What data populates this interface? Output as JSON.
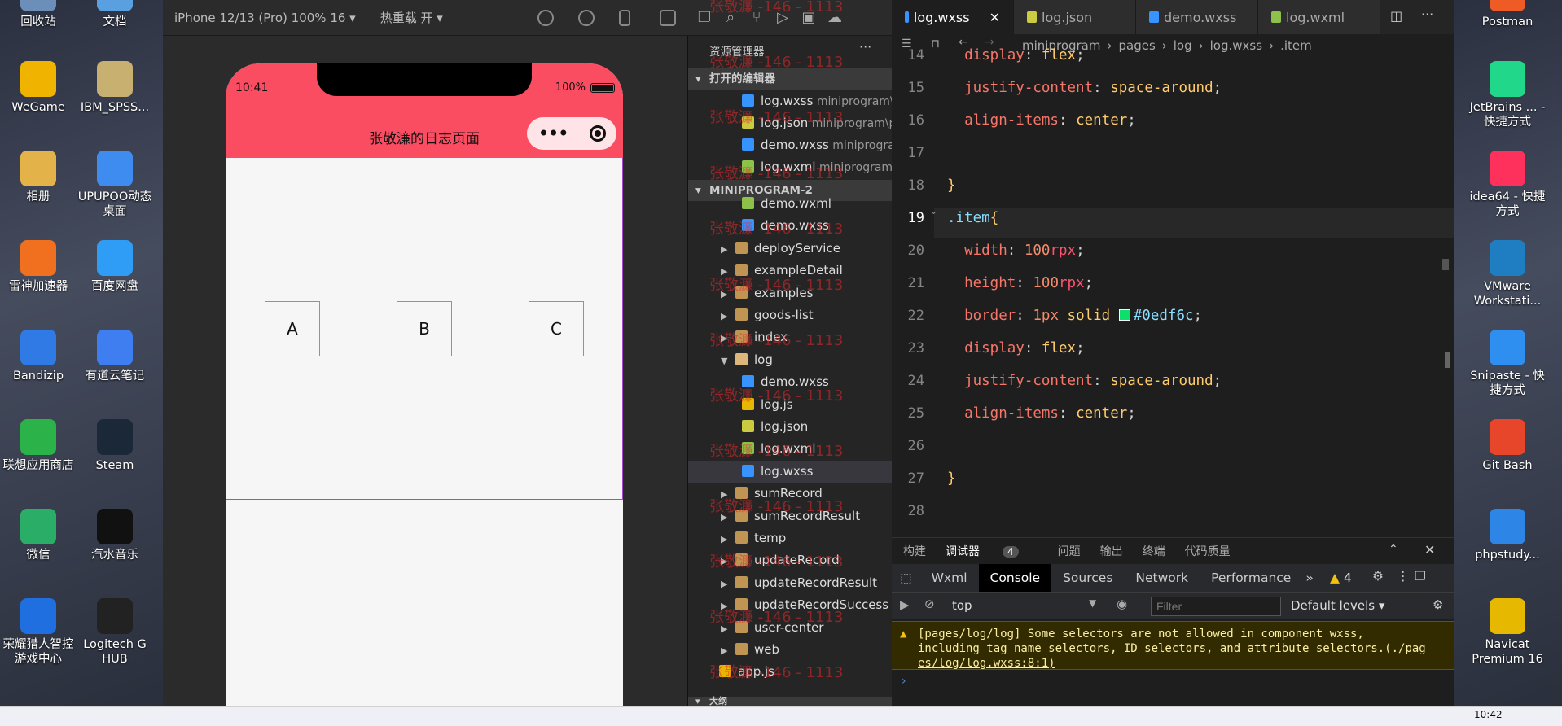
{
  "desktop_left": [
    {
      "label": "回收站",
      "icon": "recycle-bin-icon",
      "color": "#6b8fb8"
    },
    {
      "label": "文档",
      "icon": "documents-icon",
      "color": "#5aa0e0"
    },
    {
      "label": "WeGame",
      "icon": "wegame-icon",
      "color": "#f0b400"
    },
    {
      "label": "IBM_SPSS...",
      "icon": "spss-icon",
      "color": "#c8b070"
    },
    {
      "label": "相册",
      "icon": "album-icon",
      "color": "#e3b34a"
    },
    {
      "label": "UPUPOO动态桌面",
      "icon": "upupoo-icon",
      "color": "#3f8cf0"
    },
    {
      "label": "雷神加速器",
      "icon": "leishen-icon",
      "color": "#f07020"
    },
    {
      "label": "百度网盘",
      "icon": "baidu-netdisk-icon",
      "color": "#2f9cf6"
    },
    {
      "label": "Bandizip",
      "icon": "bandizip-icon",
      "color": "#2f7ae5"
    },
    {
      "label": "有道云笔记",
      "icon": "youdao-note-icon",
      "color": "#3f7ef0"
    },
    {
      "label": "联想应用商店",
      "icon": "lenovo-store-icon",
      "color": "#2bb34a"
    },
    {
      "label": "Steam",
      "icon": "steam-icon",
      "color": "#1b2838"
    },
    {
      "label": "微信",
      "icon": "wechat-icon",
      "color": "#2aae67"
    },
    {
      "label": "汽水音乐",
      "icon": "qishui-music-icon",
      "color": "#111111"
    },
    {
      "label": "荣耀猎人智控游戏中心",
      "icon": "honor-hunter-icon",
      "color": "#1f6fe0"
    },
    {
      "label": "Logitech G HUB",
      "icon": "logitech-icon",
      "color": "#222222"
    }
  ],
  "desktop_right": [
    {
      "label": "Postman",
      "icon": "postman-icon",
      "color": "#ef5b25"
    },
    {
      "label": "JetBrains ... - 快捷方式",
      "icon": "pycharm-icon",
      "color": "#21d789"
    },
    {
      "label": "idea64 - 快捷方式",
      "icon": "intellij-icon",
      "color": "#fe315d"
    },
    {
      "label": "VMware Workstati...",
      "icon": "vmware-icon",
      "color": "#1f7ec2"
    },
    {
      "label": "Snipaste - 快捷方式",
      "icon": "snipaste-icon",
      "color": "#2f8ff0"
    },
    {
      "label": "Git Bash",
      "icon": "git-bash-icon",
      "color": "#e8462b"
    },
    {
      "label": "phpstudy...",
      "icon": "phpstudy-icon",
      "color": "#2d86e6"
    },
    {
      "label": "Navicat Premium 16",
      "icon": "navicat-icon",
      "color": "#e6b800"
    }
  ],
  "simulator": {
    "device": "iPhone 12/13 (Pro) 100% 16 ▾",
    "hot_reload": "热重载 开 ▾",
    "time": "10:41",
    "battery": "100%",
    "title": "张敬濂的日志页面",
    "items": [
      "A",
      "B",
      "C"
    ]
  },
  "explorer": {
    "title": "资源管理器",
    "open_editors": "打开的编辑器",
    "project": "MINIPROGRAM-2",
    "outline": "大纲",
    "open": [
      {
        "name": "log.wxss",
        "path": "miniprogram\\p...",
        "type": "wxss"
      },
      {
        "name": "log.json",
        "path": "miniprogram\\p...",
        "type": "json"
      },
      {
        "name": "demo.wxss",
        "path": "miniprogra...",
        "type": "wxss"
      },
      {
        "name": "log.wxml",
        "path": "miniprogram\\...",
        "type": "wxml"
      }
    ],
    "tree": [
      {
        "name": "demo.wxml",
        "indent": 2,
        "type": "wxml"
      },
      {
        "name": "demo.wxss",
        "indent": 2,
        "type": "wxss"
      },
      {
        "name": "deployService",
        "indent": 1,
        "type": "folder"
      },
      {
        "name": "exampleDetail",
        "indent": 1,
        "type": "folder"
      },
      {
        "name": "examples",
        "indent": 1,
        "type": "folder"
      },
      {
        "name": "goods-list",
        "indent": 1,
        "type": "folder"
      },
      {
        "name": "index",
        "indent": 1,
        "type": "folder"
      },
      {
        "name": "log",
        "indent": 1,
        "type": "folder-open"
      },
      {
        "name": "demo.wxss",
        "indent": 2,
        "type": "wxss"
      },
      {
        "name": "log.js",
        "indent": 2,
        "type": "js"
      },
      {
        "name": "log.json",
        "indent": 2,
        "type": "json"
      },
      {
        "name": "log.wxml",
        "indent": 2,
        "type": "wxml"
      },
      {
        "name": "log.wxss",
        "indent": 2,
        "type": "wxss"
      },
      {
        "name": "sumRecord",
        "indent": 1,
        "type": "folder"
      },
      {
        "name": "sumRecordResult",
        "indent": 1,
        "type": "folder"
      },
      {
        "name": "temp",
        "indent": 1,
        "type": "folder"
      },
      {
        "name": "updateRecord",
        "indent": 1,
        "type": "folder"
      },
      {
        "name": "updateRecordResult",
        "indent": 1,
        "type": "folder"
      },
      {
        "name": "updateRecordSuccess",
        "indent": 1,
        "type": "folder"
      },
      {
        "name": "user-center",
        "indent": 1,
        "type": "folder"
      },
      {
        "name": "web",
        "indent": 1,
        "type": "folder"
      },
      {
        "name": "app.js",
        "indent": 0,
        "type": "js"
      }
    ],
    "watermark": "张敬濂 -146 - 1113"
  },
  "editor": {
    "tabs": [
      {
        "name": "log.wxss",
        "active": true,
        "type": "wxss"
      },
      {
        "name": "log.json",
        "active": false,
        "type": "json"
      },
      {
        "name": "demo.wxss",
        "active": false,
        "type": "wxss"
      },
      {
        "name": "log.wxml",
        "active": false,
        "type": "wxml"
      }
    ],
    "breadcrumb": [
      "miniprogram",
      "pages",
      "log",
      "log.wxss",
      ".item"
    ],
    "lines": [
      "14",
      "15",
      "16",
      "17",
      "18",
      "19",
      "20",
      "21",
      "22",
      "23",
      "24",
      "25",
      "26",
      "27",
      "28"
    ]
  },
  "panel": {
    "tabs": [
      "构建",
      "调试器",
      "问题",
      "输出",
      "终端",
      "代码质量"
    ],
    "debugger_count": "4",
    "devtools_tabs": [
      "Wxml",
      "Console",
      "Sources",
      "Network",
      "Performance"
    ],
    "warning_count": "4",
    "context": "top",
    "filter_placeholder": "Filter",
    "levels": "Default levels ▾",
    "warning_line1": "[pages/log/log] Some selectors are not allowed in component wxss,",
    "warning_line2": "including tag name selectors, ID selectors, and attribute selectors.(./pag",
    "warning_line3": "es/log/log.wxss:8:1)"
  },
  "taskbar": {
    "time": "10:42"
  }
}
